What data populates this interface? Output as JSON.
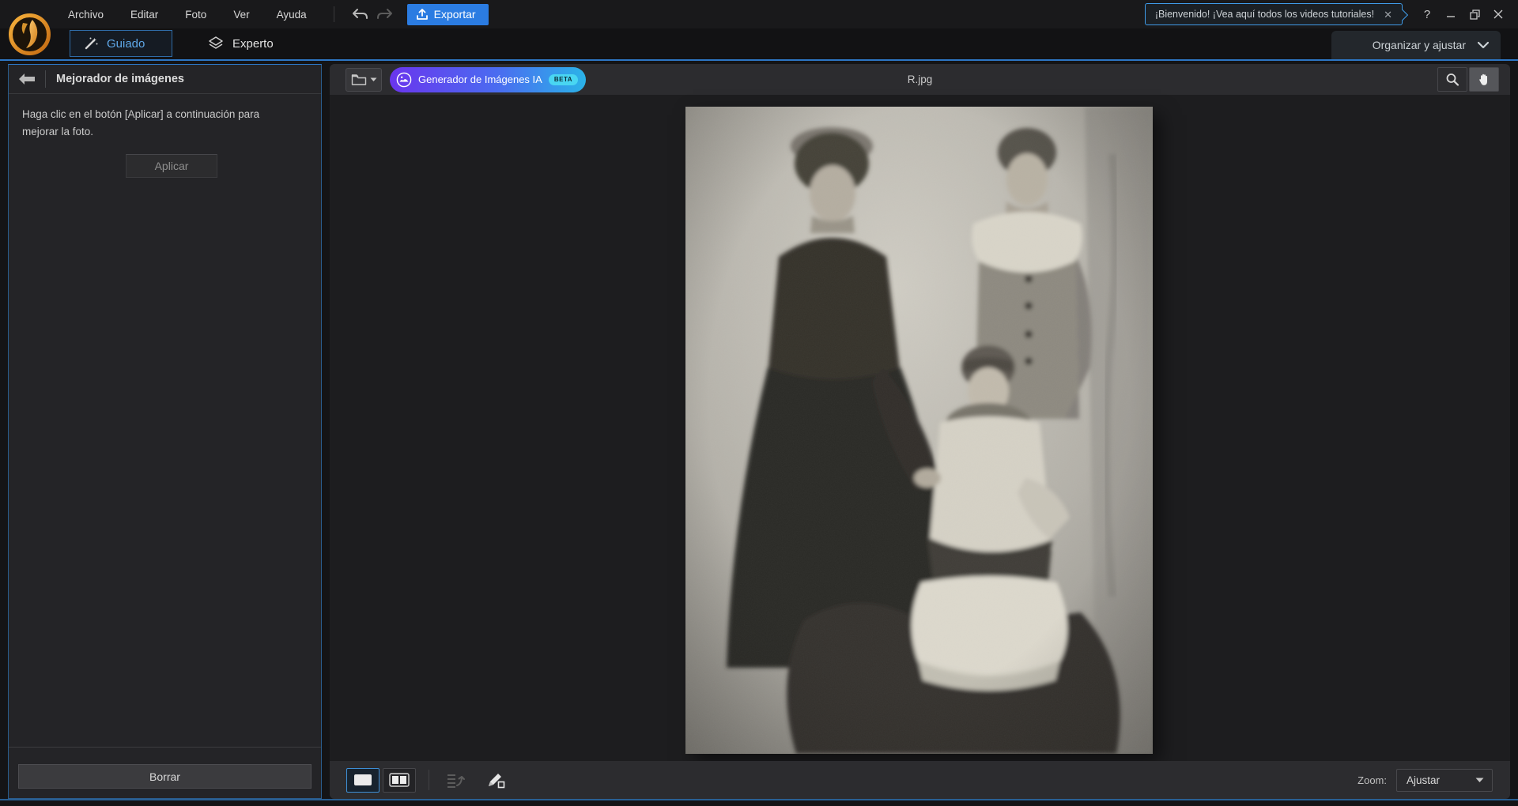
{
  "titlebar": {
    "menu": [
      "Archivo",
      "Editar",
      "Foto",
      "Ver",
      "Ayuda"
    ],
    "export_label": "Exportar",
    "welcome_tooltip": "¡Bienvenido! ¡Vea aquí todos los videos tutoriales!",
    "help_label": "?"
  },
  "modebar": {
    "guided_label": "Guiado",
    "expert_label": "Experto",
    "organize_label": "Organizar y ajustar"
  },
  "left_panel": {
    "title": "Mejorador de imágenes",
    "instruction": "Haga clic en el botón [Aplicar] a continuación para mejorar la foto.",
    "apply_label": "Aplicar",
    "clear_label": "Borrar"
  },
  "content_toolbar": {
    "ai_button_label": "Generador de Imágenes IA",
    "beta_label": "BETA",
    "filename": "R.jpg"
  },
  "statusbar": {
    "zoom_label": "Zoom:",
    "zoom_value": "Ajustar"
  },
  "icons": {
    "logo": "photodirector-logo",
    "undo": "undo-icon",
    "redo": "redo-icon",
    "export": "export-upload-icon",
    "tooltip_close": "close-icon",
    "help": "help-icon",
    "minimize": "minimize-icon",
    "restore": "restore-window-icon",
    "close": "close-window-icon",
    "guided": "magic-wand-icon",
    "expert": "layers-icon",
    "organize": "chevron-down-icon",
    "back": "back-arrow-icon",
    "folder": "folder-icon",
    "ai": "ai-image-icon",
    "magnifier": "zoom-magnifier-icon",
    "hand": "hand-pan-icon",
    "single_view": "single-view-icon",
    "split_view": "split-view-icon",
    "copy_adjust": "copy-adjustments-icon",
    "pencil": "edit-pencil-icon"
  },
  "colors": {
    "accent_blue": "#2d76c4",
    "export_blue": "#2b7ce2",
    "ai_gradient_start": "#6a35ee",
    "ai_gradient_end": "#2bb3e8",
    "beta_cyan": "#49d6f2",
    "guided_text_blue": "#5fa8e8",
    "panel_bg": "#242427",
    "toolbar_bg": "#2c2c2f"
  }
}
